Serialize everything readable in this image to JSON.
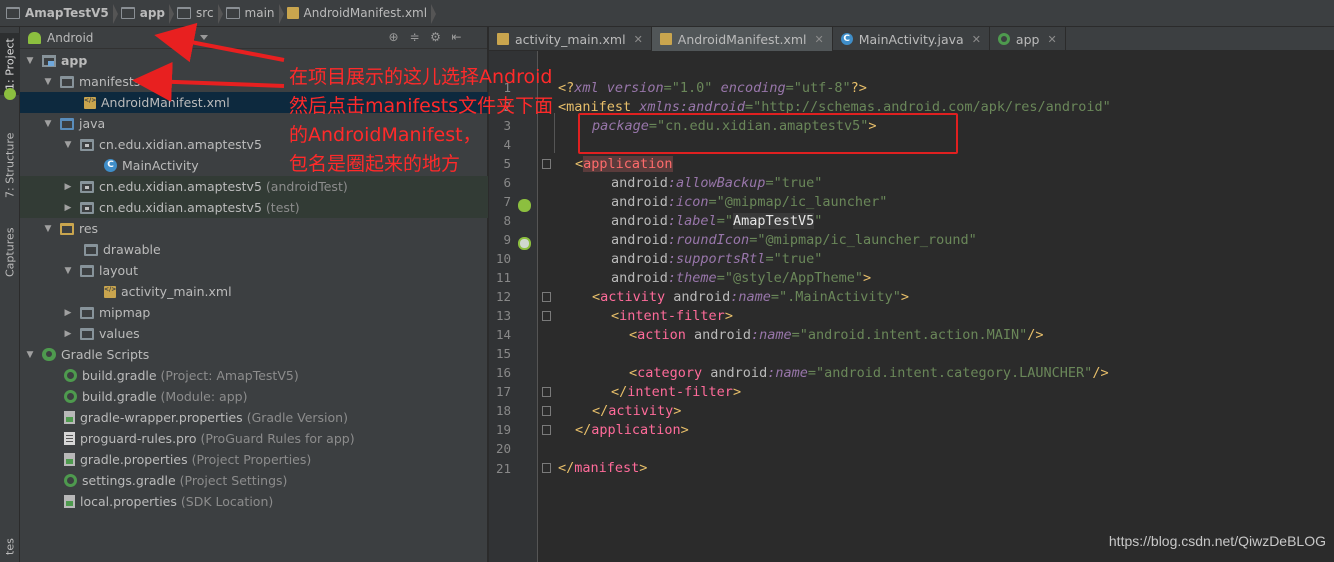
{
  "breadcrumbs": [
    "AmapTestV5",
    "app",
    "src",
    "main",
    "AndroidManifest.xml"
  ],
  "tool_stripe": {
    "project": "1: Project",
    "structure": "7: Structure",
    "captures": "Captures",
    "favorites": "tes"
  },
  "project_panel": {
    "view_selector": "Android",
    "tree": [
      {
        "label": "app",
        "hint": ""
      },
      {
        "label": "manifests",
        "hint": ""
      },
      {
        "label": "AndroidManifest.xml",
        "hint": ""
      },
      {
        "label": "java",
        "hint": ""
      },
      {
        "label": "cn.edu.xidian.amaptestv5",
        "hint": ""
      },
      {
        "label": "MainActivity",
        "hint": ""
      },
      {
        "label": "cn.edu.xidian.amaptestv5",
        "hint": "(androidTest)"
      },
      {
        "label": "cn.edu.xidian.amaptestv5",
        "hint": "(test)"
      },
      {
        "label": "res",
        "hint": ""
      },
      {
        "label": "drawable",
        "hint": ""
      },
      {
        "label": "layout",
        "hint": ""
      },
      {
        "label": "activity_main.xml",
        "hint": ""
      },
      {
        "label": "mipmap",
        "hint": ""
      },
      {
        "label": "values",
        "hint": ""
      },
      {
        "label": "Gradle Scripts",
        "hint": ""
      },
      {
        "label": "build.gradle",
        "hint": "(Project: AmapTestV5)"
      },
      {
        "label": "build.gradle",
        "hint": "(Module: app)"
      },
      {
        "label": "gradle-wrapper.properties",
        "hint": "(Gradle Version)"
      },
      {
        "label": "proguard-rules.pro",
        "hint": "(ProGuard Rules for app)"
      },
      {
        "label": "gradle.properties",
        "hint": "(Project Properties)"
      },
      {
        "label": "settings.gradle",
        "hint": "(Project Settings)"
      },
      {
        "label": "local.properties",
        "hint": "(SDK Location)"
      }
    ]
  },
  "editor_tabs": [
    {
      "label": "activity_main.xml",
      "icon": "xml-file-icon"
    },
    {
      "label": "AndroidManifest.xml",
      "icon": "xml-file-icon"
    },
    {
      "label": "MainActivity.java",
      "icon": "class-icon"
    },
    {
      "label": "app",
      "icon": "gradle-icon"
    }
  ],
  "line_numbers": [
    "1",
    "2",
    "3",
    "4",
    "5",
    "6",
    "7",
    "8",
    "9",
    "10",
    "11",
    "12",
    "13",
    "14",
    "15",
    "16",
    "17",
    "18",
    "19",
    "20",
    "21"
  ],
  "code": {
    "l1_a": "<?",
    "l1_b": "xml version",
    "l1_c": "=\"1.0\" ",
    "l1_d": "encoding",
    "l1_e": "=\"utf-8\"",
    "l1_f": "?>",
    "l2_a": "<manifest ",
    "l2_b": "xmlns:android",
    "l2_c": "=\"http://schemas.android.com/apk/res/android\"",
    "l3_a": "package",
    "l3_b": "=\"cn.edu.xidian.amaptestv5\"",
    "l3_c": ">",
    "l5_a": "<",
    "l5_b": "application",
    "l6_a": "android",
    "l6_b": ":allowBackup",
    "l6_c": "=\"true\"",
    "l7_a": "android",
    "l7_b": ":icon",
    "l7_c": "=\"@mipmap/ic_launcher\"",
    "l8_a": "android",
    "l8_b": ":label",
    "l8_c": "=\"",
    "l8_d": "AmapTestV5",
    "l8_e": "\"",
    "l9_a": "android",
    "l9_b": ":roundIcon",
    "l9_c": "=\"@mipmap/ic_launcher_round\"",
    "l10_a": "android",
    "l10_b": ":supportsRtl",
    "l10_c": "=\"true\"",
    "l11_a": "android",
    "l11_b": ":theme",
    "l11_c": "=\"@style/AppTheme\"",
    "l11_d": ">",
    "l12_a": "<",
    "l12_b": "activity ",
    "l12_c": "android",
    "l12_d": ":name",
    "l12_e": "=\".MainActivity\"",
    "l12_f": ">",
    "l13_a": "<",
    "l13_b": "intent-filter",
    "l13_c": ">",
    "l14_a": "<",
    "l14_b": "action ",
    "l14_c": "android",
    "l14_d": ":name",
    "l14_e": "=\"android.intent.action.MAIN\"",
    "l14_f": "/>",
    "l16_a": "<",
    "l16_b": "category ",
    "l16_c": "android",
    "l16_d": ":name",
    "l16_e": "=\"android.intent.category.LAUNCHER\"",
    "l16_f": "/>",
    "l17_a": "</",
    "l17_b": "intent-filter",
    "l17_c": ">",
    "l18_a": "</",
    "l18_b": "activity",
    "l18_c": ">",
    "l19_a": "</",
    "l19_b": "application",
    "l19_c": ">",
    "l21_a": "</",
    "l21_b": "manifest",
    "l21_c": ">"
  },
  "annotation": {
    "line1": "在项目展示的这儿选择Android",
    "line2": "然后点击manifests文件夹下面",
    "line3": "的AndroidManifest，",
    "line4": "包名是圈起来的地方"
  },
  "watermark": "https://blog.csdn.net/QiwzDeBLOG",
  "colors": {
    "annotation": "#ff2a2a",
    "selection": "#0d293e",
    "editor_bg": "#2b2b2b"
  }
}
